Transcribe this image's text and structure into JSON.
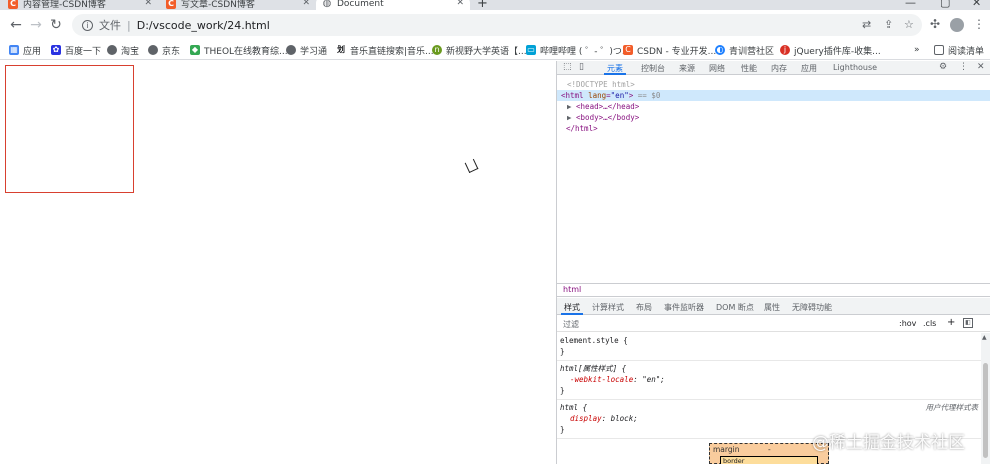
{
  "browser": {
    "tabs": [
      {
        "title": "内容管理-CSDN博客",
        "favicon": "csdn-icon"
      },
      {
        "title": "写文章-CSDN博客",
        "favicon": "csdn-icon"
      },
      {
        "title": "Document",
        "favicon": "globe-icon"
      }
    ],
    "active_tab_index": 2,
    "new_tab_label": "+",
    "omnibox": {
      "protocol_label": "文件",
      "url": "D:/vscode_work/24.html"
    },
    "bookmarks": [
      {
        "label": "应用",
        "icon": "apps-grid-icon"
      },
      {
        "label": "百度一下",
        "icon": "baidu-icon"
      },
      {
        "label": "淘宝",
        "icon": "globe-icon"
      },
      {
        "label": "京东",
        "icon": "globe-icon"
      },
      {
        "label": "THEOL在线教育综...",
        "icon": "theol-icon"
      },
      {
        "label": "学习通",
        "icon": "globe-icon"
      },
      {
        "label": "音乐直链搜索|音乐...",
        "icon": "music-icon"
      },
      {
        "label": "新视野大学英语【...",
        "icon": "book-icon"
      },
      {
        "label": "哔哩哔哩 ( ゜- ゜)つ...",
        "icon": "bilibili-icon"
      },
      {
        "label": "CSDN - 专业开发...",
        "icon": "csdn-icon"
      },
      {
        "label": "青训营社区",
        "icon": "community-icon"
      },
      {
        "label": "jQuery插件库-收集...",
        "icon": "jquery-icon"
      }
    ],
    "bookmarks_overflow": "»",
    "reading_list_label": "阅读清单"
  },
  "devtools": {
    "top_tabs": [
      "元素",
      "控制台",
      "来源",
      "网络",
      "性能",
      "内存",
      "应用",
      "Lighthouse"
    ],
    "active_top_tab": "元素",
    "dom": {
      "doctype": "<!DOCTYPE html>",
      "html_open_prefix": "<html ",
      "html_attr_name": "lang",
      "html_attr_value": "\"en\"",
      "html_open_suffix": ">",
      "selected_marker": " == $0",
      "head": "<head>…</head>",
      "body": "<body>…</body>",
      "html_close": "</html>"
    },
    "breadcrumb": "html",
    "sub_tabs": [
      "样式",
      "计算样式",
      "布局",
      "事件监听器",
      "DOM 断点",
      "属性",
      "无障碍功能"
    ],
    "active_sub_tab": "样式",
    "filter_placeholder": "过滤",
    "hov_label": ":hov",
    "cls_label": ".cls",
    "add_rule_label": "+",
    "styles": {
      "element_style_selector": "element.style {",
      "close_brace": "}",
      "attr_rule_selector": "html[属性样式] {",
      "attr_rule_prop": "-webkit-locale",
      "attr_rule_value": "\"en\";",
      "ua_rule_selector": "html {",
      "ua_rule_prop": "display",
      "ua_rule_value": "block;",
      "ua_origin": "用户代理样式表"
    },
    "box_model": {
      "margin_label": "margin",
      "margin_value": "-",
      "border_label": "border"
    }
  },
  "watermark": "@稀土掘金技术社区",
  "colors": {
    "page_box_border": "#d8402f",
    "devtools_accent": "#1a73e8",
    "selected_row": "#cfe8fc"
  }
}
